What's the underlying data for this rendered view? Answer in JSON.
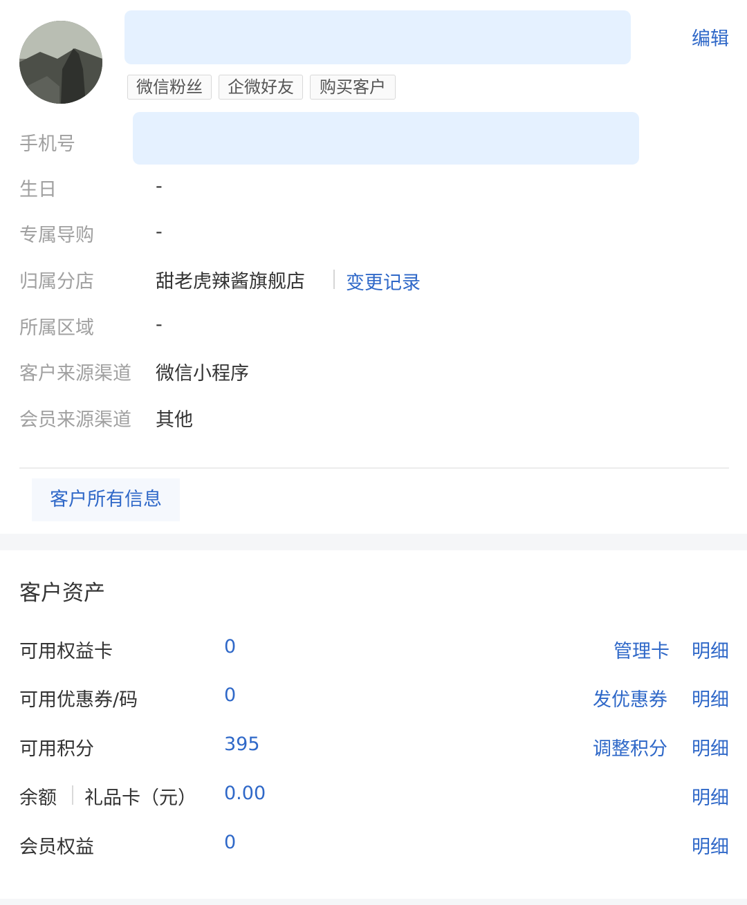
{
  "header": {
    "edit_label": "编辑",
    "tags": [
      "微信粉丝",
      "企微好友",
      "购买客户"
    ]
  },
  "info": {
    "phone_label": "手机号",
    "birthday_label": "生日",
    "birthday_value": "-",
    "guide_label": "专属导购",
    "guide_value": "-",
    "store_label": "归属分店",
    "store_value": "甜老虎辣酱旗舰店",
    "store_history_link": "变更记录",
    "region_label": "所属区域",
    "region_value": "-",
    "customer_source_label": "客户来源渠道",
    "customer_source_value": "微信小程序",
    "member_source_label": "会员来源渠道",
    "member_source_value": "其他",
    "all_info_button": "客户所有信息"
  },
  "assets": {
    "title": "客户资产",
    "rows": [
      {
        "label": "可用权益卡",
        "value": "0",
        "action": "管理卡",
        "detail": "明细"
      },
      {
        "label": "可用优惠券/码",
        "value": "0",
        "action": "发优惠券",
        "detail": "明细"
      },
      {
        "label": "可用积分",
        "value": "395",
        "action": "调整积分",
        "detail": "明细"
      },
      {
        "label_a": "余额",
        "label_b": "礼品卡（元）",
        "value": "0.00",
        "detail": "明细"
      },
      {
        "label": "会员权益",
        "value": "0",
        "detail": "明细"
      }
    ]
  },
  "colors": {
    "link": "#2f68c8",
    "muted_label": "#a0a0a0",
    "redaction": "#e5f1ff"
  }
}
